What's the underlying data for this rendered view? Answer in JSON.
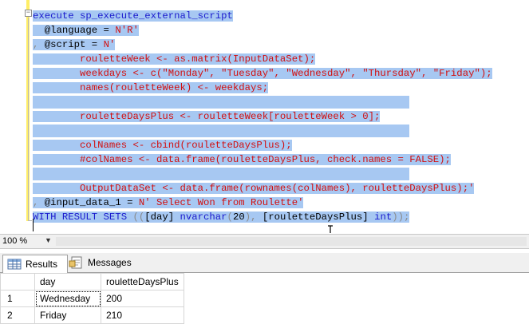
{
  "editor": {
    "lines": [
      [
        {
          "t": "execute sp_execute_external_script",
          "c": "kw"
        }
      ],
      [
        {
          "t": "  @language = ",
          "c": ""
        },
        {
          "t": "N'R'",
          "c": "str"
        }
      ],
      [
        {
          "t": ", ",
          "c": "gr"
        },
        {
          "t": "@script = ",
          "c": ""
        },
        {
          "t": "N'",
          "c": "str"
        }
      ],
      [
        {
          "t": "        rouletteWeek <- as.matrix(InputDataSet);",
          "c": "str"
        }
      ],
      [
        {
          "t": "        weekdays <- c(\"Monday\", \"Tuesday\", \"Wednesday\", \"Thursday\", \"Friday\");",
          "c": "str"
        }
      ],
      [
        {
          "t": "        names(rouletteWeek) <- weekdays;",
          "c": "str"
        }
      ],
      [],
      [
        {
          "t": "        rouletteDaysPlus <- rouletteWeek[rouletteWeek > 0];",
          "c": "str"
        }
      ],
      [],
      [
        {
          "t": "        colNames <- cbind(rouletteDaysPlus);",
          "c": "str"
        }
      ],
      [
        {
          "t": "        #colNames <- data.frame(rouletteDaysPlus, check.names = FALSE);",
          "c": "str"
        }
      ],
      [],
      [
        {
          "t": "        OutputDataSet <- data.frame(rownames(colNames), rouletteDaysPlus);'",
          "c": "str"
        }
      ],
      [
        {
          "t": ", ",
          "c": "gr"
        },
        {
          "t": "@input_data_1 = ",
          "c": ""
        },
        {
          "t": "N' Select Won from Roulette'",
          "c": "str"
        }
      ],
      [
        {
          "t": "WITH RESULT SETS ",
          "c": "kw"
        },
        {
          "t": "((",
          "c": "gr"
        },
        {
          "t": "[day] ",
          "c": ""
        },
        {
          "t": "nvarchar",
          "c": "kw"
        },
        {
          "t": "(",
          "c": "gr"
        },
        {
          "t": "20",
          "c": ""
        },
        {
          "t": "), ",
          "c": "gr"
        },
        {
          "t": "[rouletteDaysPlus] ",
          "c": ""
        },
        {
          "t": "int",
          "c": "kw"
        },
        {
          "t": "));",
          "c": "gr"
        }
      ]
    ]
  },
  "zoom": {
    "level": "100 %"
  },
  "tabs": {
    "results": "Results",
    "messages": "Messages"
  },
  "grid": {
    "columns": [
      "day",
      "rouletteDaysPlus"
    ],
    "rows": [
      {
        "num": "1",
        "day": "Wednesday",
        "value": "200"
      },
      {
        "num": "2",
        "day": "Friday",
        "value": "210"
      }
    ]
  }
}
